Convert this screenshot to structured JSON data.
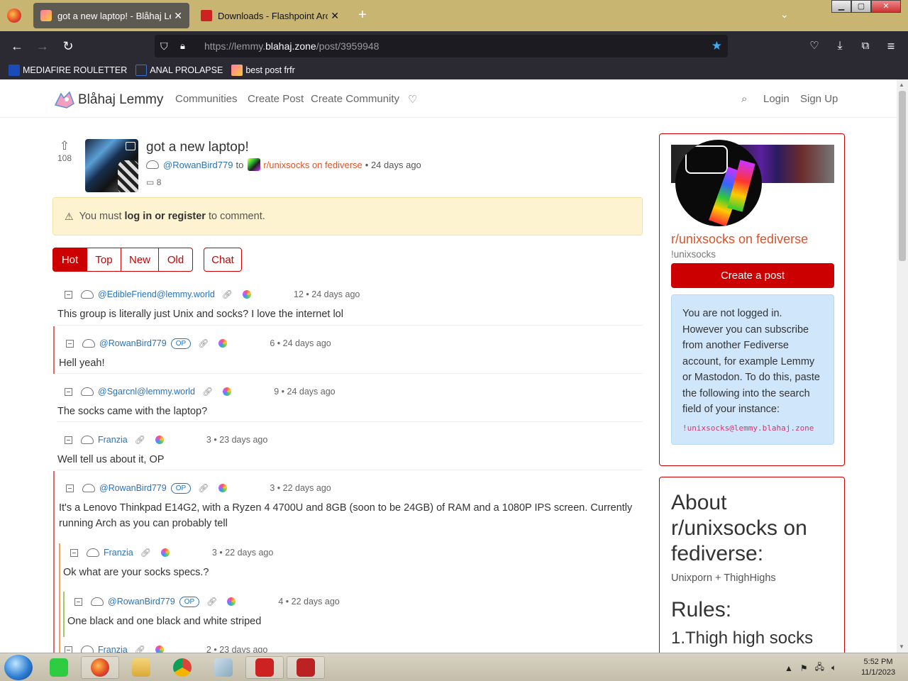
{
  "browser": {
    "tabs": [
      {
        "title": "got a new laptop! - Blåhaj Lemmy",
        "active": true
      },
      {
        "title": "Downloads - Flashpoint Archive",
        "active": false
      }
    ],
    "new_tab": "+",
    "url_prefix": "https://lemmy.",
    "url_domain": "blahaj.zone",
    "url_path": "/post/3959948",
    "bookmarks": [
      "MEDIAFIRE ROULETTER",
      "ANAL PROLAPSE",
      "best post frfr"
    ]
  },
  "site": {
    "brand": "Blåhaj Lemmy",
    "nav": [
      "Communities",
      "Create Post",
      "Create Community"
    ],
    "login": "Login",
    "signup": "Sign Up"
  },
  "post": {
    "score": "108",
    "title": "got a new laptop!",
    "author": "@RowanBird779",
    "to": "to",
    "community": "r/unixsocks on fediverse",
    "age": "• 24 days ago",
    "comments": "8"
  },
  "alert": {
    "prefix": "You must",
    "link": "log in or register",
    "suffix": "to comment."
  },
  "sort": [
    "Hot",
    "Top",
    "New",
    "Old"
  ],
  "chat": "Chat",
  "comments": [
    {
      "user": "@EdibleFriend@lemmy.world",
      "op": false,
      "meta": "12 • 24 days ago",
      "body": "This group is literally just Unix and socks? I love the internet lol"
    },
    {
      "user": "@RowanBird779",
      "op": true,
      "meta": "6 • 24 days ago",
      "body": "Hell yeah!"
    },
    {
      "user": "@Sgarcnl@lemmy.world",
      "op": false,
      "meta": "9 • 24 days ago",
      "body": "The socks came with the laptop?"
    },
    {
      "user": "Franzia",
      "op": false,
      "meta": "3 • 23 days ago",
      "body": "Well tell us about it, OP"
    },
    {
      "user": "@RowanBird779",
      "op": true,
      "meta": "3 • 22 days ago",
      "body": "It's a Lenovo Thinkpad E14G2, with a Ryzen 4 4700U and 8GB (soon to be 24GB) of RAM and a 1080P IPS screen. Currently running Arch as you can probably tell"
    },
    {
      "user": "Franzia",
      "op": false,
      "meta": "3 • 22 days ago",
      "body": "Ok what are your socks specs.?"
    },
    {
      "user": "@RowanBird779",
      "op": true,
      "meta": "4 • 22 days ago",
      "body": "One black and one black and white striped"
    },
    {
      "user": "Franzia",
      "op": false,
      "meta": "2 • 23 days ago",
      "body": ""
    }
  ],
  "op_label": "OP",
  "sidebar": {
    "community_name": "r/unixsocks on fediverse",
    "handle": "!unixsocks",
    "create_post": "Create a post",
    "not_logged": "You are not logged in. However you can subscribe from another Fediverse account, for example Lemmy or Mastodon. To do this, paste the following into the search field of your instance:",
    "fed_handle": "!unixsocks@lemmy.blahaj.zone",
    "about_title": "About r/unixsocks on fediverse:",
    "about_desc": "Unixporn + ThighHighs",
    "rules_title": "Rules:",
    "rule1": "1.Thigh high socks"
  },
  "taskbar": {
    "time": "5:52 PM",
    "date": "11/1/2023"
  }
}
